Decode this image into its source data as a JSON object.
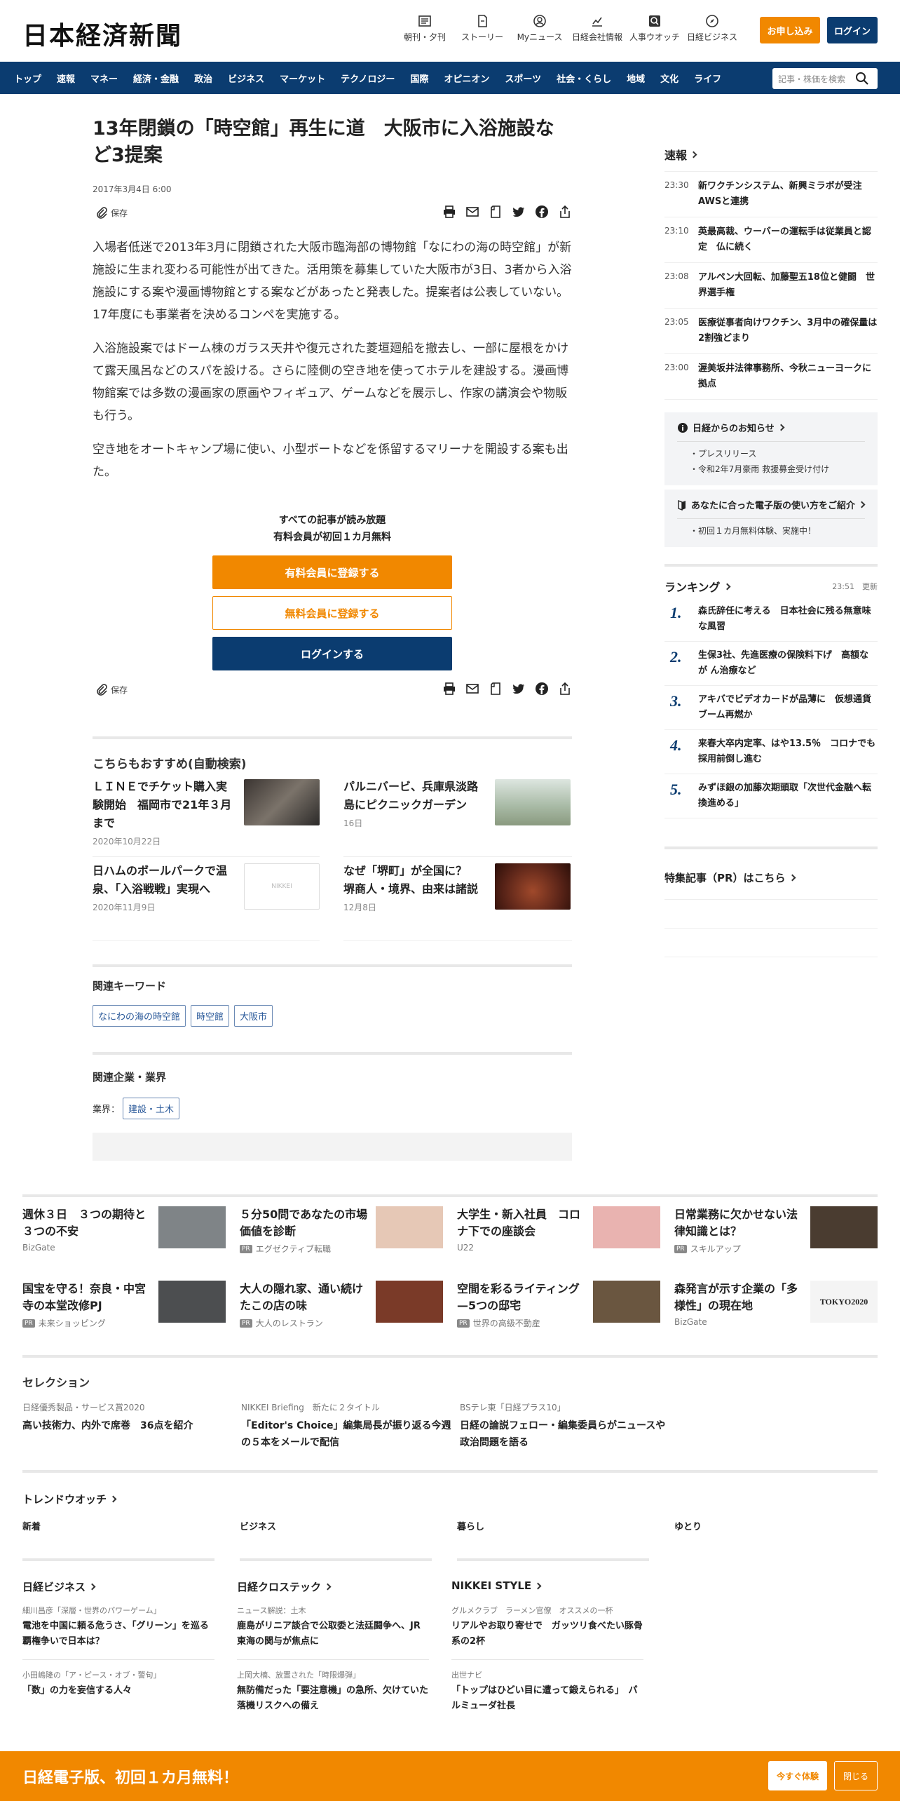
{
  "header": {
    "logo": "日本経済新聞",
    "nav": [
      {
        "label": "朝刊・夕刊",
        "icon": "newspaper-icon"
      },
      {
        "label": "ストーリー",
        "icon": "story-icon"
      },
      {
        "label": "Myニュース",
        "icon": "user-icon"
      },
      {
        "label": "日経会社情報",
        "icon": "chart-icon"
      },
      {
        "label": "人事ウオッチ",
        "icon": "search-person-icon"
      },
      {
        "label": "日経ビジネス",
        "icon": "compass-icon"
      }
    ],
    "apply_label": "お申し込み",
    "login_label": "ログイン"
  },
  "global_nav": {
    "items": [
      "トップ",
      "速報",
      "マネー",
      "経済・金融",
      "政治",
      "ビジネス",
      "マーケット",
      "テクノロジー",
      "国際",
      "オピニオン",
      "スポーツ",
      "社会・くらし",
      "地域",
      "文化",
      "ライフ"
    ],
    "search_placeholder": "記事・株価を検索"
  },
  "article": {
    "title": "13年閉鎖の「時空館」再生に道　大阪市に入浴施設など3提案",
    "date": "2017年3月4日 6:00",
    "save_label": "保存",
    "paragraphs": [
      "入場者低迷で2013年3月に閉鎖された大阪市臨海部の博物館「なにわの海の時空館」が新施設に生まれ変わる可能性が出てきた。活用策を募集していた大阪市が3日、3者から入浴施設にする案や漫画博物館とする案などがあったと発表した。提案者は公表していない。17年度にも事業者を決めるコンペを実施する。",
      "入浴施設案ではドーム棟のガラス天井や復元された菱垣廻船を撤去し、一部に屋根をかけて露天風呂などのスパを設ける。さらに陸側の空き地を使ってホテルを建設する。漫画博物館案では多数の漫画家の原画やフィギュア、ゲームなどを展示し、作家の講演会や物販も行う。",
      "空き地をオートキャンプ場に使い、小型ボートなどを係留するマリーナを開設する案も出た。"
    ],
    "paywall": {
      "line1": "すべての記事が読み放題",
      "line2": "有料会員が初回１カ月無料",
      "paid_label": "有料会員に登録する",
      "free_label": "無料会員に登録する",
      "login_label": "ログインする"
    }
  },
  "recommend": {
    "title": "こちらもおすすめ(自動検索)",
    "items": [
      {
        "title": "ＬＩＮＥでチケット購入実験開始　福岡市で21年３月まで",
        "date": "2020年10月22日",
        "thumb_color": "#5a5550"
      },
      {
        "title": "パルニバービ、兵庫県淡路島にピクニックガーデン",
        "date": "16日",
        "thumb_color": "#b9c6b2"
      },
      {
        "title": "日ハムのボールパークで温泉、「入浴戦戦」実現へ",
        "date": "2020年11月9日",
        "thumb_label": "NIKKEI",
        "thumb_color": "#ffffff"
      },
      {
        "title": "なぜ「堺町」が全国に？　堺商人・境界、由来は諸説",
        "date": "12月8日",
        "thumb_color": "#5a2418"
      }
    ]
  },
  "keywords": {
    "title": "関連キーワード",
    "items": [
      "なにわの海の時空館",
      "時空館",
      "大阪市"
    ]
  },
  "related_companies": {
    "title": "関連企業・業界",
    "label": "業界：",
    "industry": "建設・土木"
  },
  "sidebar": {
    "breaking_title": "速報",
    "news": [
      {
        "time": "23:30",
        "text": "新ワクチンシステム、新興ミラボが受注　AWSと連携"
      },
      {
        "time": "23:10",
        "text": "英最高裁、ウーバーの運転手は従業員と認定　仏に続く"
      },
      {
        "time": "23:08",
        "text": "アルペン大回転、加藤聖五18位と健闘　世界選手権"
      },
      {
        "time": "23:05",
        "text": "医療従事者向けワクチン、3月中の確保量は2割強どまり"
      },
      {
        "time": "23:00",
        "text": "渥美坂井法律事務所、今秋ニューヨークに拠点"
      }
    ],
    "notice_title": "日経からのお知らせ",
    "notice_items": [
      "プレスリリース",
      "令和2年7月豪雨 救援募金受け付け"
    ],
    "guide_title": "あなたに合った電子版の使い方をご紹介",
    "guide_items": [
      "初回１カ月無料体験、実施中！"
    ],
    "ranking_title": "ランキング",
    "ranking_time": "23:51",
    "ranking_update": "更新",
    "ranking": [
      {
        "num": "1.",
        "text": "森氏辞任に考える　日本社会に残る無意味な風習"
      },
      {
        "num": "2.",
        "text": "生保3社、先進医療の保険料下げ　高額なが ん治療など"
      },
      {
        "num": "3.",
        "text": "アキバでビデオカードが品薄に　仮想通貨ブーム再燃か"
      },
      {
        "num": "4.",
        "text": "来春大卒内定率、はや13.5％　コロナでも採用前倒し進む"
      },
      {
        "num": "5.",
        "text": "みずほ銀の加藤次期頭取「次世代金融へ転換進める」"
      }
    ],
    "pr_title": "特集記事（PR）はこちら"
  },
  "promo_grid": [
    {
      "title": "週休３日　３つの期待と３つの不安",
      "source": "BizGate",
      "pr": false,
      "thumb_color": "#7f8487"
    },
    {
      "title": "５分50問であなたの市場価値を診断",
      "source": "エグゼクティブ転職",
      "pr": true,
      "thumb_color": "#e6c8b6"
    },
    {
      "title": "大学生・新入社員　コロナ下での座談会",
      "source": "U22",
      "pr": false,
      "thumb_color": "#e9b3b0"
    },
    {
      "title": "日常業務に欠かせない法律知識とは？",
      "source": "スキルアップ",
      "pr": true,
      "thumb_color": "#4a3c30"
    },
    {
      "title": "国宝を守る！奈良・中宮寺の本堂改修PJ",
      "source": "未来ショッピング",
      "pr": true,
      "thumb_color": "#4c4e50"
    },
    {
      "title": "大人の隠れ家、通い続けたこの店の味",
      "source": "大人のレストラン",
      "pr": true,
      "thumb_color": "#7a3a28"
    },
    {
      "title": "空間を彩るライティング—5つの邸宅",
      "source": "世界の高級不動産",
      "pr": true,
      "thumb_color": "#6a5640"
    },
    {
      "title": "森発言が示す企業の「多様性」の現在地",
      "source": "BizGate",
      "pr": false,
      "thumb_label": "TOKYO2020",
      "thumb_color": "#f4f4f4"
    }
  ],
  "selection": {
    "title": "セレクション",
    "items": [
      {
        "sub": "日経優秀製品・サービス賞2020",
        "title": "高い技術力、内外で席巻　36点を紹介"
      },
      {
        "sub": "NIKKEI Briefing　新たに２タイトル",
        "title": "「Editor's Choice」編集局長が振り返る今週の５本をメールで配信"
      },
      {
        "sub": "BSテレ東「日経プラス10」",
        "title": "日経の論説フェロー・編集委員らがニュースや政治問題を語る"
      }
    ]
  },
  "trend": {
    "title": "トレンドウオッチ",
    "tabs": [
      "新着",
      "ビジネス",
      "暮らし",
      "ゆとり"
    ]
  },
  "media": [
    {
      "name": "日経ビジネス",
      "items": [
        {
          "sub": "細川昌彦「深層・世界のパワーゲーム」",
          "title": "電池を中国に頼る危うさ、「グリーン」を巡る覇権争いで日本は？"
        },
        {
          "sub": "小田嶋隆の「ア・ピース・オブ・警句」",
          "title": "「数」の力を妄信する人々"
        }
      ]
    },
    {
      "name": "日経クロステック",
      "items": [
        {
          "sub": "ニュース解説：土木",
          "title": "鹿島がリニア談合で公取委と法廷闘争へ、JR東海の関与が焦点に"
        },
        {
          "sub": "上岡大楠、放置された「時限爆弾」",
          "title": "無防備だった「要注意機」の急所、欠けていた落機リスクへの備え"
        }
      ]
    },
    {
      "name": "NIKKEI STYLE",
      "items": [
        {
          "sub": "グルメクラブ　ラーメン官僚　オススメの一杯",
          "title": "リアルやお取り寄せで　ガッツリ食べたい豚骨系の2杯"
        },
        {
          "sub": "出世ナビ",
          "title": "「トップはひどい目に遭って鍛えられる」　パルミューダ社長"
        }
      ]
    }
  ],
  "banner": {
    "text": "日経電子版、初回１カ月無料！",
    "trial_label": "今すぐ体験",
    "close_label": "閉じる"
  }
}
